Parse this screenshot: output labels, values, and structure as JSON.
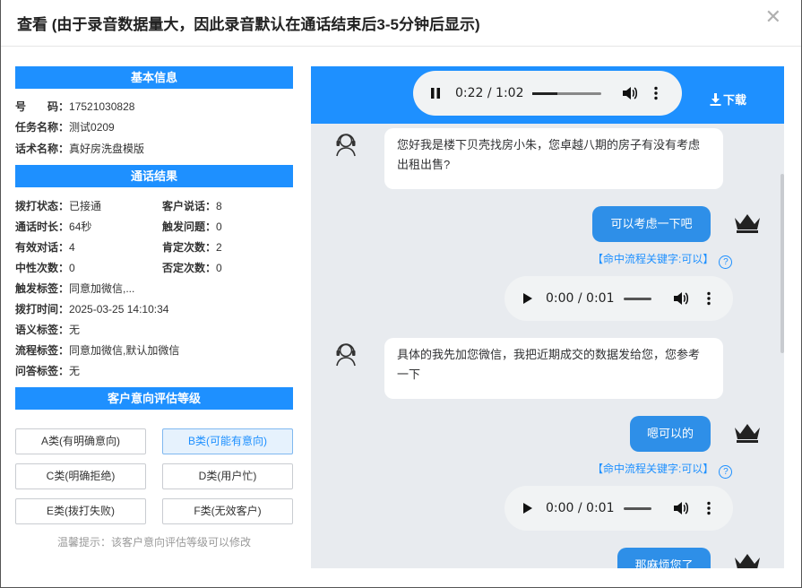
{
  "dialog": {
    "title": "查看 (由于录音数据量大，因此录音默认在通话结束后3-5分钟后显示)",
    "close_glyph": "✕"
  },
  "basic_info": {
    "heading": "基本信息",
    "rows": [
      {
        "label": "号　　码：",
        "value": "17521030828"
      },
      {
        "label": "任务名称：",
        "value": "测试0209"
      },
      {
        "label": "话术名称：",
        "value": "真好房洗盘模版"
      }
    ]
  },
  "call_result": {
    "heading": "通话结果",
    "pairs": [
      {
        "label": "拨打状态：",
        "value": "已接通"
      },
      {
        "label": "客户说话：",
        "value": "8"
      },
      {
        "label": "通话时长：",
        "value": "64秒"
      },
      {
        "label": "触发问题：",
        "value": "0"
      },
      {
        "label": "有效对话：",
        "value": "4"
      },
      {
        "label": "肯定次数：",
        "value": "2"
      },
      {
        "label": "中性次数：",
        "value": "0"
      },
      {
        "label": "否定次数：",
        "value": "0"
      }
    ],
    "rows": [
      {
        "label": "触发标签：",
        "value": "同意加微信,..."
      },
      {
        "label": "拨打时间：",
        "value": "2025-03-25 14:10:34"
      },
      {
        "label": "语义标签：",
        "value": "无"
      },
      {
        "label": "流程标签：",
        "value": "同意加微信,默认加微信"
      },
      {
        "label": "问答标签：",
        "value": "无"
      }
    ]
  },
  "intent": {
    "heading": "客户意向评估等级",
    "grades": [
      "A类(有明确意向)",
      "B类(可能有意向)",
      "C类(明确拒绝)",
      "D类(用户忙)",
      "E类(拨打失败)",
      "F类(无效客户)"
    ],
    "selected": "B类(可能有意向)",
    "hint": "温馨提示：该客户意向评估等级可以修改"
  },
  "recording": {
    "main_time": "0:22 / 1:02",
    "main_progress": 0.36,
    "download_label": "下载"
  },
  "conversation": {
    "msg1": "您好我是楼下贝壳找房小朱，您卓越八期的房子有没有考虑出租出售?",
    "reply1": "可以考虑一下吧",
    "keyword1": "【命中流程关键字:可以】",
    "audio1_time": "0:00 / 0:01",
    "msg2": "具体的我先加您微信，我把近期成交的数据发给您，您参考一下",
    "reply2": "嗯可以的",
    "keyword2": "【命中流程关键字:可以】",
    "audio2_time": "0:00 / 0:01",
    "reply3": "那麻烦您了"
  },
  "colors": {
    "accent": "#1e90ff",
    "bubble_user": "#2e8fe8",
    "chat_bg": "#e8ebef"
  }
}
